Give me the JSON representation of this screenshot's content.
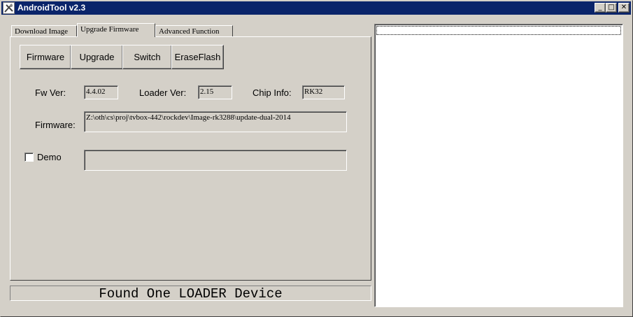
{
  "window": {
    "title": "AndroidTool v2.3",
    "minimize_glyph": "_",
    "maximize_glyph": "□",
    "close_glyph": "✕"
  },
  "tabs": [
    {
      "label": "Download Image",
      "active": false
    },
    {
      "label": "Upgrade Firmware",
      "active": true
    },
    {
      "label": "Advanced Function",
      "active": false
    }
  ],
  "buttons": {
    "firmware": "Firmware",
    "upgrade": "Upgrade",
    "switch": "Switch",
    "erase_flash": "EraseFlash"
  },
  "info": {
    "fw_ver_label": "Fw Ver:",
    "fw_ver_value": "4.4.02",
    "loader_ver_label": "Loader Ver:",
    "loader_ver_value": "2.15",
    "chip_info_label": "Chip Info:",
    "chip_info_value": "RK32",
    "firmware_label": "Firmware:",
    "firmware_path": "Z:\\oth\\cs\\proj\\tvbox-442\\rockdev\\Image-rk3288\\update-dual-2014"
  },
  "demo": {
    "label": "Demo",
    "checked": false,
    "value": ""
  },
  "status": {
    "text": "Found One LOADER Device"
  }
}
